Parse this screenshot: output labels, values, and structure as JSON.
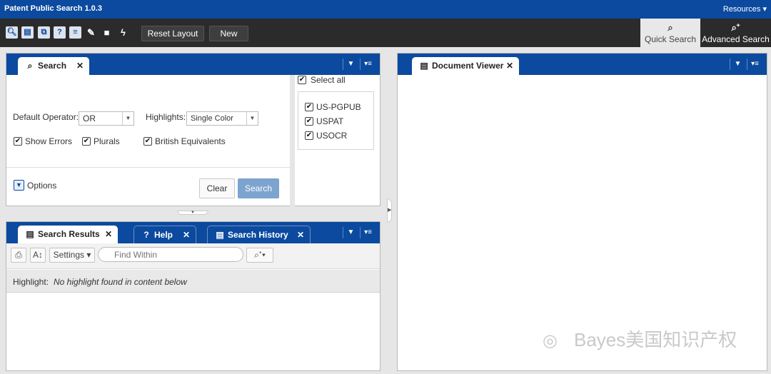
{
  "app": {
    "title": "Patent Public Search 1.0.3",
    "resources_label": "Resources ▾"
  },
  "toolbar": {
    "reset_layout_label": "Reset Layout",
    "new_label": "New",
    "quick_search_label": "Quick Search",
    "advanced_search_label": "Advanced Search"
  },
  "search_panel": {
    "tab_label": "Search",
    "default_operator_label": "Default Operator:",
    "default_operator_value": "OR",
    "highlights_label": "Highlights:",
    "highlights_value": "Single Color",
    "show_errors_label": "Show Errors",
    "plurals_label": "Plurals",
    "british_equivalents_label": "British Equivalents",
    "options_label": "Options",
    "clear_label": "Clear",
    "search_label": "Search",
    "select_all_label": "Select all",
    "databases": [
      {
        "label": "US-PGPUB",
        "checked": true
      },
      {
        "label": "USPAT",
        "checked": true
      },
      {
        "label": "USOCR",
        "checked": true
      }
    ]
  },
  "results_panel": {
    "tabs": [
      "Search Results",
      "Help",
      "Search History"
    ],
    "settings_label": "Settings",
    "find_placeholder": "Find Within",
    "highlight_label": "Highlight:",
    "highlight_message": "No highlight found in content below"
  },
  "document_viewer": {
    "tab_label": "Document Viewer"
  },
  "watermark": {
    "text": "Bayes美国知识产权"
  },
  "colors": {
    "brand_blue": "#0b4a9e",
    "toolbar_dark": "#2b2b2b",
    "search_button": "#7da3cf"
  }
}
